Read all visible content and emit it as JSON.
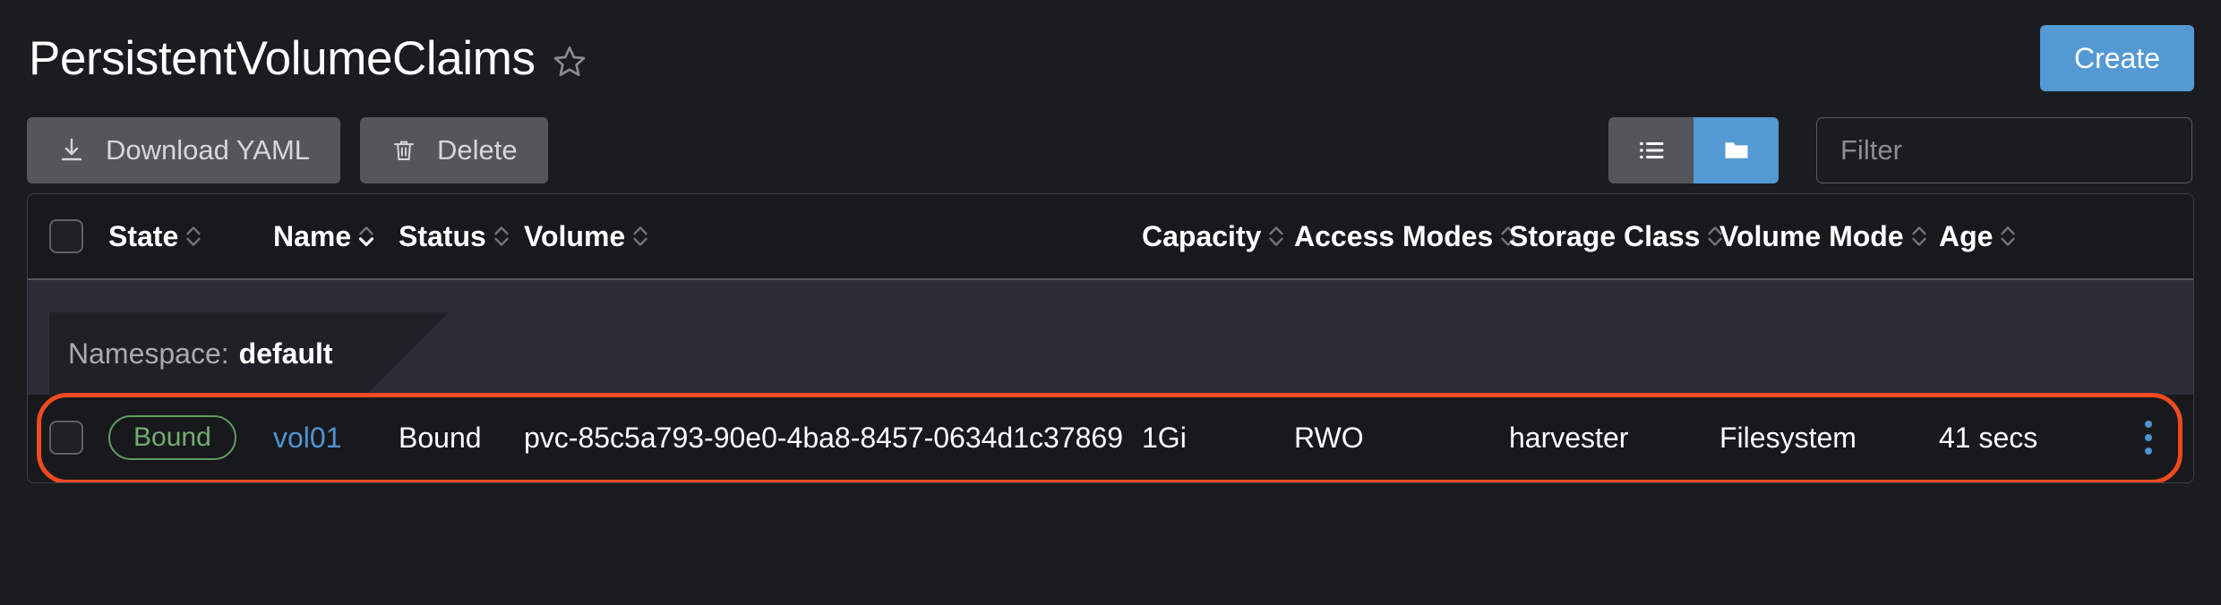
{
  "header": {
    "title": "PersistentVolumeClaims",
    "favorite_icon": "star-icon",
    "create_label": "Create"
  },
  "toolbar": {
    "download_yaml_label": "Download YAML",
    "download_icon": "download-icon",
    "delete_label": "Delete",
    "delete_icon": "trash-icon",
    "view_list_icon": "list-view-icon",
    "view_group_icon": "folder-group-icon",
    "filter_placeholder": "Filter",
    "filter_value": ""
  },
  "table": {
    "columns": [
      {
        "label": "State",
        "sorted": false
      },
      {
        "label": "Name",
        "sorted": true
      },
      {
        "label": "Status",
        "sorted": false
      },
      {
        "label": "Volume",
        "sorted": false
      },
      {
        "label": "Capacity",
        "sorted": false
      },
      {
        "label": "Access Modes",
        "sorted": false
      },
      {
        "label": "Storage Class",
        "sorted": false
      },
      {
        "label": "Volume Mode",
        "sorted": false
      },
      {
        "label": "Age",
        "sorted": false
      }
    ],
    "group": {
      "label": "Namespace:",
      "value": "default"
    },
    "rows": [
      {
        "state": "Bound",
        "name": "vol01",
        "status": "Bound",
        "volume": "pvc-85c5a793-90e0-4ba8-8457-0634d1c37869",
        "capacity": "1Gi",
        "access_modes": "RWO",
        "storage_class": "harvester",
        "volume_mode": "Filesystem",
        "age": "41 secs",
        "highlighted": true
      }
    ]
  },
  "colors": {
    "accent_blue": "#5499d4",
    "highlight_border": "#f04a20",
    "state_green": "#73ad70",
    "link_blue": "#4f94d1",
    "button_gray": "#55565b",
    "page_bg": "#1b1c20"
  }
}
